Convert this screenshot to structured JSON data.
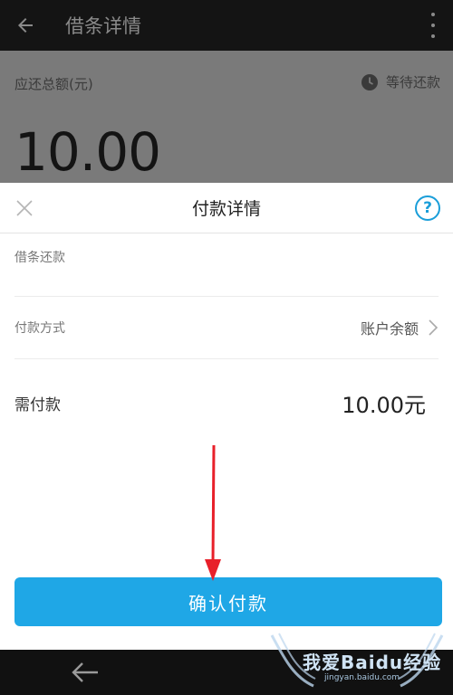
{
  "appbar": {
    "title": "借条详情"
  },
  "background_panel": {
    "label": "应还总额(元)",
    "status": "等待还款",
    "amount": "10.00"
  },
  "sheet": {
    "title": "付款详情",
    "help_symbol": "?",
    "rows": [
      {
        "label": "借条还款"
      },
      {
        "label": "付款方式",
        "value": "账户余额"
      },
      {
        "label": "需付款",
        "value": "10.00元"
      }
    ],
    "confirm_label": "确认付款"
  },
  "watermark": {
    "main": "我爱Baidu经验",
    "sub": "jingyan.baidu.com"
  },
  "colors": {
    "accent": "#1fa7e6",
    "annotation_red": "#e8202a"
  }
}
